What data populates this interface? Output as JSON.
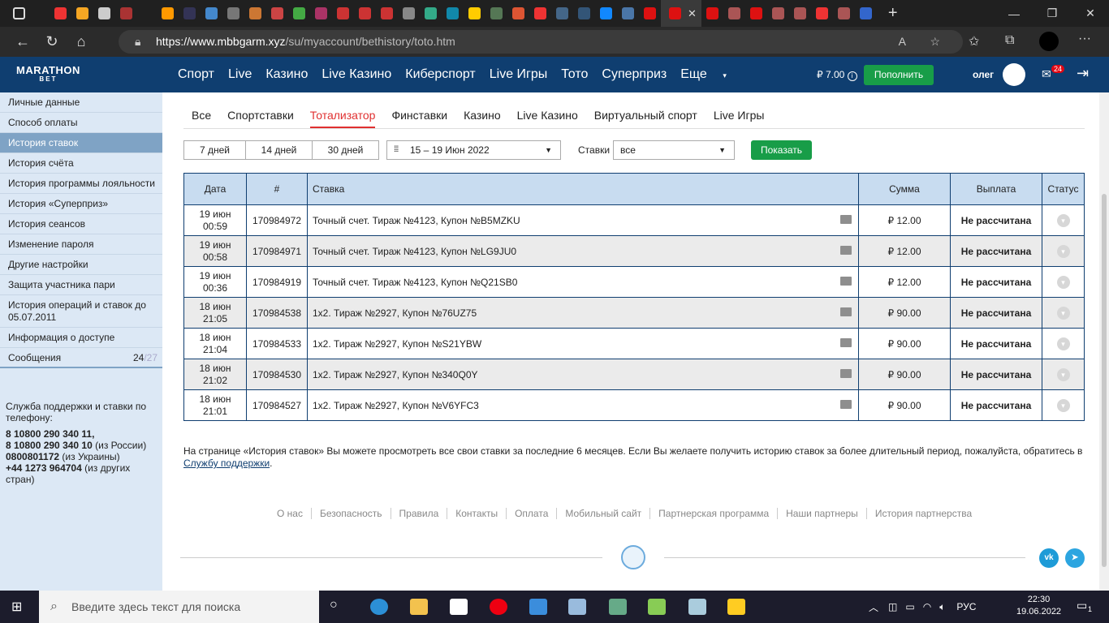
{
  "browser": {
    "url_domain": "https://www.mbbgarm.xyz",
    "url_path": "/su/myaccount/bethistory/toto.htm"
  },
  "header": {
    "logo_line1": "MARATHON",
    "logo_line2": "BET",
    "nav": [
      "Спорт",
      "Live",
      "Казино",
      "Live Казино",
      "Киберспорт",
      "Live Игры",
      "Тото",
      "Суперприз",
      "Еще"
    ],
    "balance": "₽ 7.00",
    "topup": "Пополнить",
    "user": "олег",
    "mail_count": "24"
  },
  "sidebar": {
    "items": [
      "Личные данные",
      "Способ оплаты",
      "История ставок",
      "История счёта",
      "История программы лояльности",
      "История «Суперприз»",
      "История сеансов",
      "Изменение пароля",
      "Другие настройки",
      "Защита участника пари",
      "История операций и ставок до 05.07.2011",
      "Информация о доступе",
      "Сообщения"
    ],
    "messages_count": "24",
    "messages_total": "/27",
    "support_title": "Служба поддержки и ставки по телефону:",
    "phone1": "8 10800 290 340 11,",
    "phone2": "8 10800 290 340 10",
    "phone2_note": "(из России)",
    "phone3": "0800801172",
    "phone3_note": "(из Украины)",
    "phone4": "+44 1273 964704",
    "phone4_note": "(из других стран)"
  },
  "tabs": [
    "Все",
    "Спортставки",
    "Тотализатор",
    "Финставки",
    "Казино",
    "Live Казино",
    "Виртуальный спорт",
    "Live Игры"
  ],
  "filters": {
    "periods": [
      "7 дней",
      "14 дней",
      "30 дней"
    ],
    "date_range": "15 – 19 Июн 2022",
    "bets_label": "Ставки",
    "bets_value": "все",
    "show_button": "Показать"
  },
  "table": {
    "headers": [
      "Дата",
      "#",
      "Ставка",
      "Сумма",
      "Выплата",
      "Статус"
    ],
    "rows": [
      {
        "date": "19 июн",
        "time": "00:59",
        "id": "170984972",
        "bet": "Точный счет. Тираж №4123, Купон №B5MZKU",
        "sum": "₽ 12.00",
        "payout": "Не рассчитана"
      },
      {
        "date": "19 июн",
        "time": "00:58",
        "id": "170984971",
        "bet": "Точный счет. Тираж №4123, Купон №LG9JU0",
        "sum": "₽ 12.00",
        "payout": "Не рассчитана"
      },
      {
        "date": "19 июн",
        "time": "00:36",
        "id": "170984919",
        "bet": "Точный счет. Тираж №4123, Купон №Q21SB0",
        "sum": "₽ 12.00",
        "payout": "Не рассчитана"
      },
      {
        "date": "18 июн",
        "time": "21:05",
        "id": "170984538",
        "bet": "1х2. Тираж №2927, Купон №76UZ75",
        "sum": "₽ 90.00",
        "payout": "Не рассчитана"
      },
      {
        "date": "18 июн",
        "time": "21:04",
        "id": "170984533",
        "bet": "1х2. Тираж №2927, Купон №S21YBW",
        "sum": "₽ 90.00",
        "payout": "Не рассчитана"
      },
      {
        "date": "18 июн",
        "time": "21:02",
        "id": "170984530",
        "bet": "1х2. Тираж №2927, Купон №340Q0Y",
        "sum": "₽ 90.00",
        "payout": "Не рассчитана"
      },
      {
        "date": "18 июн",
        "time": "21:01",
        "id": "170984527",
        "bet": "1х2. Тираж №2927, Купон №V6YFC3",
        "sum": "₽ 90.00",
        "payout": "Не рассчитана"
      }
    ]
  },
  "note": {
    "text": "На странице «История ставок» Вы можете просмотреть все свои ставки за последние 6 месяцев. Если Вы желаете получить историю ставок за более длительный период, пожалуйста, обратитесь в",
    "link": "Службу поддержки"
  },
  "footer_links": [
    "О нас",
    "Безопасность",
    "Правила",
    "Контакты",
    "Оплата",
    "Мобильный сайт",
    "Партнерская программа",
    "Наши партнеры",
    "История партнерства"
  ],
  "taskbar": {
    "search_placeholder": "Введите здесь текст для поиска",
    "lang": "РУС",
    "time": "22:30",
    "date": "19.06.2022",
    "notifications": "1"
  },
  "colors": {
    "brand": "#0f3e70",
    "accent_green": "#189d48",
    "active_tab": "#e03030"
  }
}
